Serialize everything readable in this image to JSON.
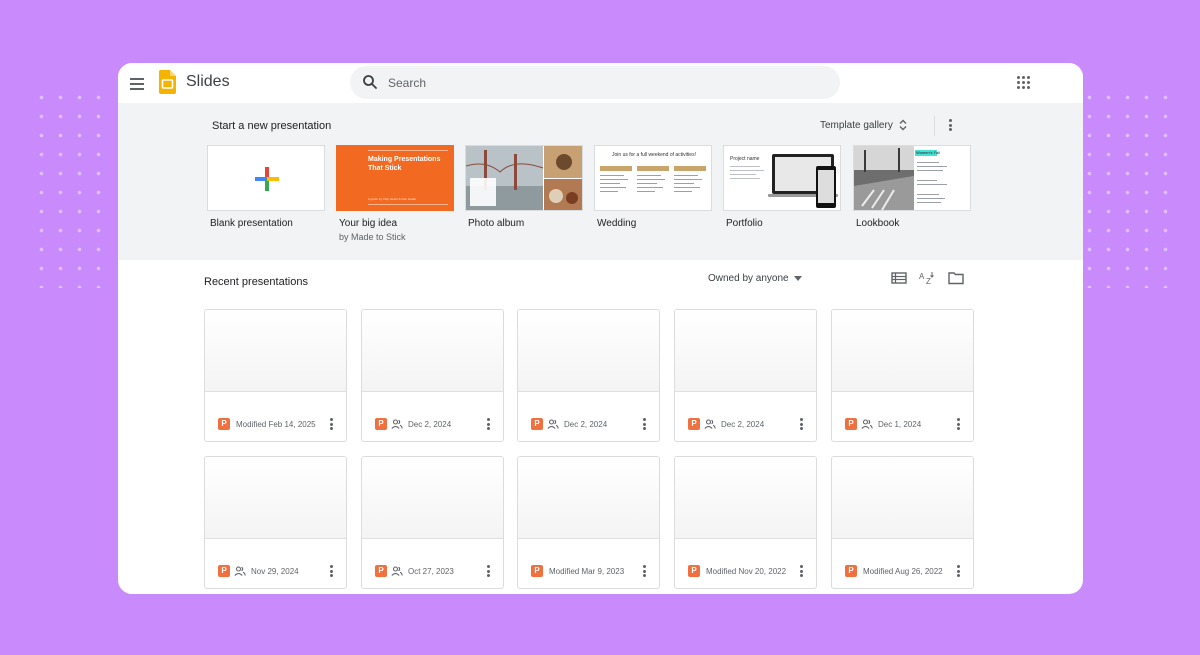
{
  "app": {
    "title": "Slides"
  },
  "search": {
    "placeholder": "Search"
  },
  "templates_section": {
    "title": "Start a new presentation",
    "gallery_label": "Template gallery",
    "items": [
      {
        "label": "Blank presentation",
        "sub": ""
      },
      {
        "label": "Your big idea",
        "sub": "by Made to Stick",
        "thumb_title": "Making Presentations That Stick",
        "thumb_caption": "A guide by Chip Heath & Dan Heath"
      },
      {
        "label": "Photo album",
        "sub": ""
      },
      {
        "label": "Wedding",
        "sub": "",
        "thumb_title": "Join us for a full weekend of activities!"
      },
      {
        "label": "Portfolio",
        "sub": "",
        "thumb_title": "Project name"
      },
      {
        "label": "Lookbook",
        "sub": "",
        "thumb_title": "Women's Fall"
      }
    ]
  },
  "recent": {
    "title": "Recent presentations",
    "filter_label": "Owned by anyone",
    "file_icon_letter": "P",
    "files": [
      {
        "date": "Modified Feb 14, 2025",
        "shared": false
      },
      {
        "date": "Dec 2, 2024",
        "shared": true
      },
      {
        "date": "Dec 2, 2024",
        "shared": true
      },
      {
        "date": "Dec 2, 2024",
        "shared": true
      },
      {
        "date": "Dec 1, 2024",
        "shared": true
      },
      {
        "date": "Nov 29, 2024",
        "shared": true
      },
      {
        "date": "Oct 27, 2023",
        "shared": true
      },
      {
        "date": "Modified Mar 9, 2023",
        "shared": false
      },
      {
        "date": "Modified Nov 20, 2022",
        "shared": false
      },
      {
        "date": "Modified Aug 26, 2022",
        "shared": false
      }
    ]
  },
  "colors": {
    "background": "#c98bfc",
    "slides_brand": "#f4b400",
    "file_icon": "#f07040",
    "your_big_idea": "#f26a21"
  }
}
